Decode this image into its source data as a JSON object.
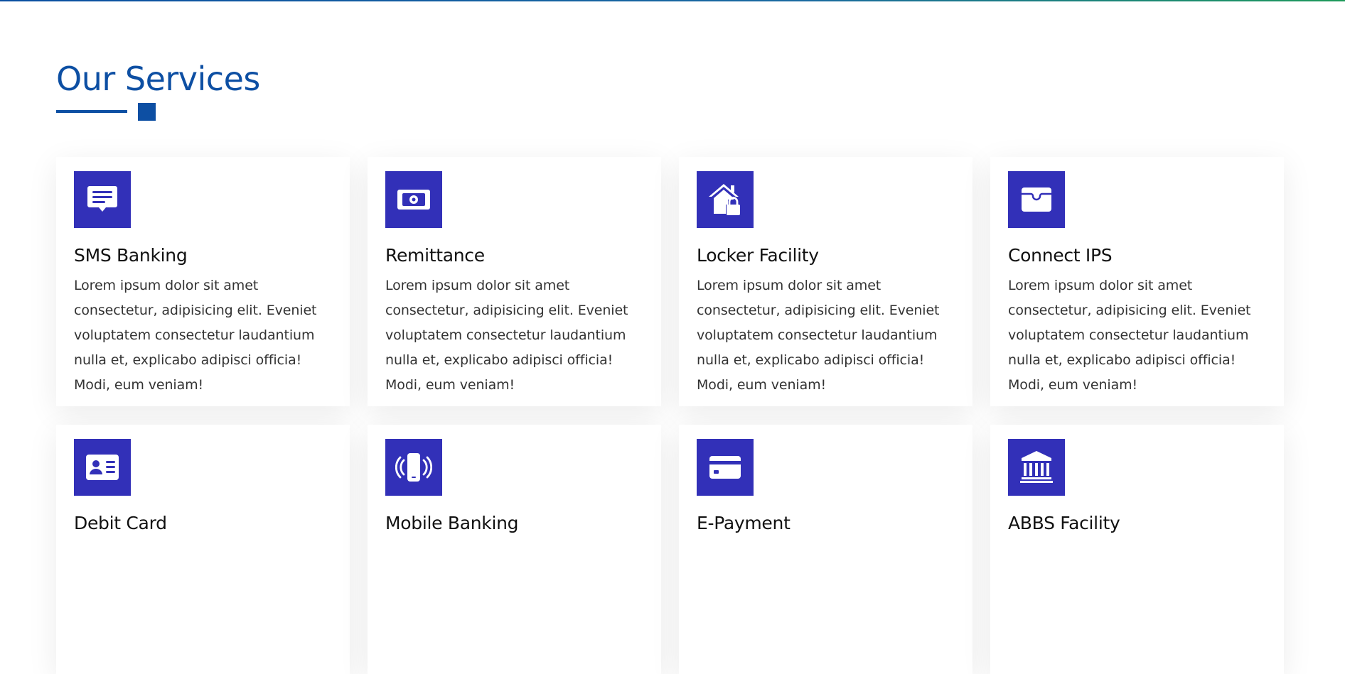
{
  "section": {
    "title": "Our Services"
  },
  "colors": {
    "brand": "#0d4fa3",
    "icon_bg": "#3230b8",
    "top_line_start": "#0a4fa0",
    "top_line_end": "#1e9a5a"
  },
  "services": [
    {
      "title": "SMS Banking",
      "icon": "message-icon",
      "description": "Lorem ipsum dolor sit amet consectetur, adipisicing elit. Eveniet voluptatem consectetur laudantium nulla et, explicabo adipisci officia! Modi, eum veniam!"
    },
    {
      "title": "Remittance",
      "icon": "money-bill-icon",
      "description": "Lorem ipsum dolor sit amet consectetur, adipisicing elit. Eveniet voluptatem consectetur laudantium nulla et, explicabo adipisci officia! Modi, eum veniam!"
    },
    {
      "title": "Locker Facility",
      "icon": "house-lock-icon",
      "description": "Lorem ipsum dolor sit amet consectetur, adipisicing elit. Eveniet voluptatem consectetur laudantium nulla et, explicabo adipisci officia! Modi, eum veniam!"
    },
    {
      "title": "Connect IPS",
      "icon": "wallet-icon",
      "description": "Lorem ipsum dolor sit amet consectetur, adipisicing elit. Eveniet voluptatem consectetur laudantium nulla et, explicabo adipisci officia! Modi, eum veniam!"
    },
    {
      "title": "Debit Card",
      "icon": "id-card-icon",
      "description": ""
    },
    {
      "title": "Mobile Banking",
      "icon": "mobile-signal-icon",
      "description": ""
    },
    {
      "title": "E-Payment",
      "icon": "credit-card-icon",
      "description": ""
    },
    {
      "title": "ABBS Facility",
      "icon": "bank-building-icon",
      "description": ""
    }
  ]
}
